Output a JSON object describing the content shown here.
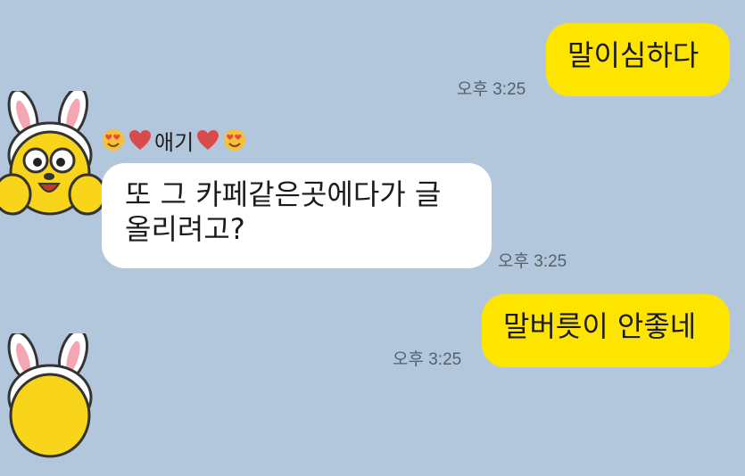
{
  "messages": {
    "m1": {
      "text": "말이심하다",
      "time": "오후 3:25"
    },
    "m2": {
      "sender": "애기",
      "text_line1": "또 그 카페같은곳에다가 글",
      "text_line2": "올리려고?",
      "time": "오후 3:25"
    },
    "m3": {
      "text": "말버릇이 안좋네",
      "time": "오후 3:25"
    }
  },
  "colors": {
    "background": "#b3c7dc",
    "my_bubble": "#fee500",
    "other_bubble": "#ffffff"
  },
  "icons": {
    "avatar": "bunny-ear-character-avatar-icon",
    "emoji": "heart-eyes-emoji-icon",
    "heart": "red-heart-icon"
  }
}
